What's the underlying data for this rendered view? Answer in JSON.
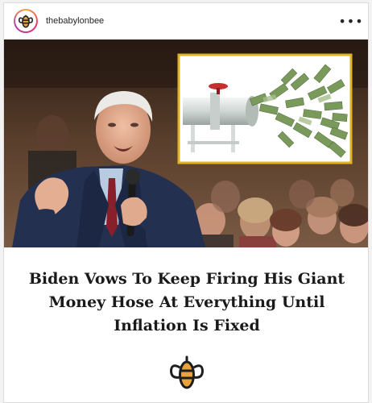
{
  "post": {
    "username": "thebabylonbee",
    "more_options": "•••",
    "headline": "Biden Vows To Keep Firing His Giant Money Hose At Everything Until Inflation Is Fixed"
  },
  "icons": {
    "avatar": "babylon-bee-logo",
    "more": "more-options-icon",
    "footer_logo": "babylon-bee-logo"
  },
  "colors": {
    "logo_gold": "#e8a33c",
    "headline": "#1a1a1a",
    "inset_border": "#e0b324",
    "money_green": "#6a8a4f"
  }
}
